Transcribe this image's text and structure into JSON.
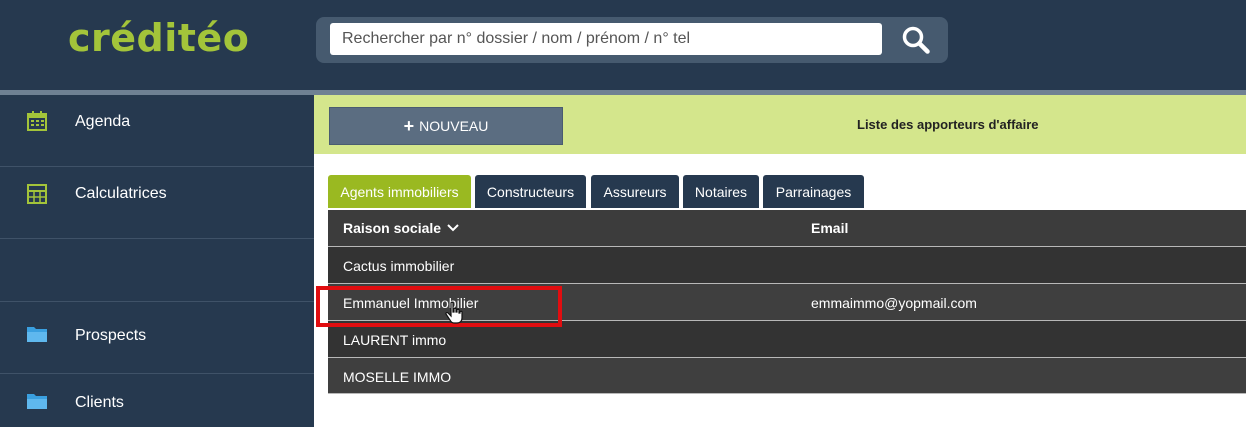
{
  "brand": {
    "logo": "créditéo",
    "accent": "#a3c43a"
  },
  "search": {
    "placeholder": "Rechercher par n° dossier / nom / prénom / n° tel"
  },
  "sidebar": {
    "items": [
      {
        "label": "Agenda",
        "icon": "calendar-icon"
      },
      {
        "label": "Calculatrices",
        "icon": "calculator-icon"
      },
      {
        "label": "Prospects",
        "icon": "folder-icon"
      },
      {
        "label": "Clients",
        "icon": "folder-icon"
      }
    ]
  },
  "toolbar": {
    "new_label": "NOUVEAU",
    "title": "Liste des apporteurs d'affaire"
  },
  "tabs": [
    {
      "label": "Agents immobiliers",
      "active": true
    },
    {
      "label": "Constructeurs",
      "active": false
    },
    {
      "label": "Assureurs",
      "active": false
    },
    {
      "label": "Notaires",
      "active": false
    },
    {
      "label": "Parrainages",
      "active": false
    }
  ],
  "table": {
    "columns": [
      "Raison sociale",
      "Email"
    ],
    "rows": [
      {
        "name": "Cactus immobilier",
        "email": ""
      },
      {
        "name": "Emmanuel Immobilier",
        "email": "emmaimmo@yopmail.com"
      },
      {
        "name": "LAURENT immo",
        "email": ""
      },
      {
        "name": "MOSELLE IMMO",
        "email": ""
      }
    ]
  },
  "colors": {
    "header": "#26394f",
    "toolbar": "#d4e68c",
    "active_tab": "#9ab921",
    "highlight": "#e10d10"
  }
}
